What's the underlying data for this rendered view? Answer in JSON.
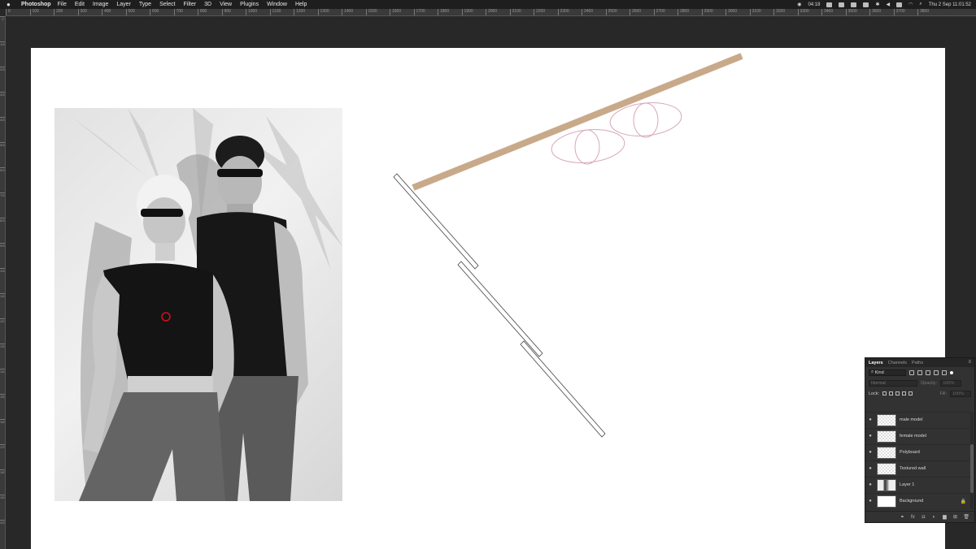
{
  "menubar": {
    "apple": "",
    "app_name": "Photoshop",
    "menus": [
      "File",
      "Edit",
      "Image",
      "Layer",
      "Type",
      "Select",
      "Filter",
      "3D",
      "View",
      "Plugins",
      "Window",
      "Help"
    ],
    "timer": "04:18",
    "clock": "Thu 2 Sep  11:01:52"
  },
  "ruler": {
    "h_ticks": [
      "0",
      "100",
      "200",
      "300",
      "400",
      "500",
      "600",
      "700",
      "800",
      "900",
      "1000",
      "1100",
      "1200",
      "1300",
      "1400",
      "1500",
      "1600",
      "1700",
      "1800",
      "1900",
      "2000",
      "2100",
      "2200",
      "2300",
      "2400",
      "2500",
      "2600",
      "2700",
      "2800",
      "2900",
      "3000",
      "3100",
      "3200",
      "3300",
      "3400",
      "3500",
      "3600",
      "3700",
      "3800"
    ],
    "v_ticks": [
      "0",
      "100",
      "200",
      "300",
      "400",
      "500",
      "600",
      "700",
      "800",
      "900",
      "1000",
      "1100",
      "1200",
      "1300",
      "1400",
      "1500",
      "1600",
      "1700",
      "1800",
      "1900",
      "2000"
    ]
  },
  "colors": {
    "polyboard": "#c8a98a",
    "light": "#d9a6b8",
    "cursor": "#d0101a",
    "walls": "#444444"
  },
  "layers_panel": {
    "tabs": [
      "Layers",
      "Channels",
      "Paths"
    ],
    "active_tab": "Layers",
    "filter_kind": "Kind",
    "blend_mode": "Normal",
    "opacity_label": "Opacity:",
    "opacity_value": "100%",
    "lock_label": "Lock:",
    "fill_label": "Fill:",
    "fill_value": "100%",
    "layers": [
      {
        "name": "male model",
        "thumb": "transparent",
        "locked": false
      },
      {
        "name": "female model",
        "thumb": "transparent",
        "locked": false
      },
      {
        "name": "Polyboard",
        "thumb": "transparent",
        "locked": false
      },
      {
        "name": "Textured wall",
        "thumb": "transparent",
        "locked": false
      },
      {
        "name": "Layer 1",
        "thumb": "photo",
        "locked": false
      },
      {
        "name": "Background",
        "thumb": "white",
        "locked": true
      }
    ],
    "footer_icons": [
      "link-icon",
      "fx-icon",
      "mask-icon",
      "adjustment-icon",
      "folder-icon",
      "new-layer-icon",
      "trash-icon"
    ],
    "footer_glyphs": [
      "⚭",
      "fx",
      "◘",
      "◐",
      "▆",
      "⊞",
      "🗑"
    ]
  }
}
